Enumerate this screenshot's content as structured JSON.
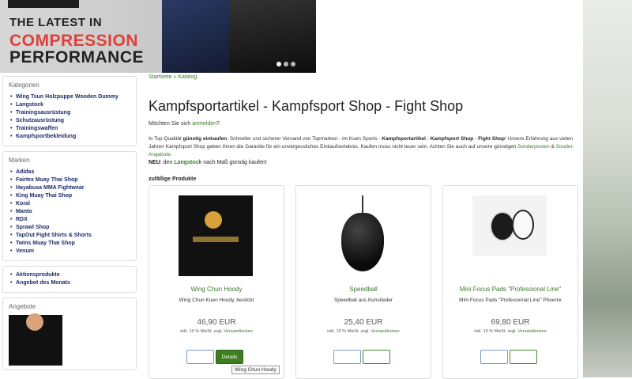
{
  "banner": {
    "line1": "THE LATEST IN",
    "line2": "COMPRESSION",
    "line3": "PERFORMANCE",
    "slides": 3,
    "active_slide": 1
  },
  "breadcrumb": {
    "home": "Startseite",
    "separator": "»",
    "current": "Katalog"
  },
  "sidebar": {
    "categories": {
      "title": "Kategorien",
      "items": [
        "Wing Tsun Holzpuppe Wooden Dummy",
        "Langstock",
        "Trainingsausrüstung",
        "Schutzausrüstung",
        "Trainingswaffen",
        "Kampfsportbekleidung"
      ]
    },
    "brands": {
      "title": "Marken",
      "items": [
        "Adidas",
        "Fairtex Muay Thai Shop",
        "Hayabusa MMA Fightwear",
        "King Muay Thai Shop",
        "Koral",
        "Manto",
        "RDX",
        "Sprawl Shop",
        "TapOut Fight Shirts & Shorts",
        "Twins Muay Thai Shop",
        "Venum"
      ]
    },
    "extra": {
      "items": [
        "Aktionsprodukte",
        "Angebot des Monats"
      ]
    },
    "offers": {
      "title": "Angebote"
    }
  },
  "main": {
    "title": "Kampfsportartikel - Kampfsport Shop - Fight Shop",
    "login_prompt": "Möchten Sie sich",
    "login_link": "anmelden",
    "login_suffix": "?",
    "intro": {
      "p1": "In Top Qualität",
      "b1": "günstig einkaufen",
      "p2": ". Schneller und sicherer Versand von Topmarken - im Kuen Sports -",
      "b2": "Kampfsportartikel",
      "p3": " -",
      "b3": "Kampfsport Shop",
      "p4": " -",
      "b4": "Fight Shop",
      "p5": "! Unsere Erfahrung aus vielen Jahren Kampfsport Shop geben Ihnen die Garantie für ein unvergessliches Einkaufserlebnis. Kaufen muss nicht teuer sein. Achten Sie auch auf unsere günstigen",
      "link1": "Sonderposten",
      "amp": " & ",
      "link2": "Sonder-Angebote",
      "end": "."
    },
    "new_line": {
      "label": "NEU",
      "text1": ": den",
      "link": "Langstock",
      "text2": "nach Maß günstig kaufen!"
    },
    "section_label": "zufällige Produkte"
  },
  "products": [
    {
      "name": "Wing Chun Hoody",
      "desc": "Wing Chun Kuen Hoody, bestickt",
      "price": "46,90 EUR",
      "tax_prefix": "inkl. 19 % MwSt. zzgl.",
      "shipping": "Versandkosten",
      "btn2": "Details"
    },
    {
      "name": "Speedball",
      "desc": "Speedball aus Kunstleder",
      "price": "25,40 EUR",
      "tax_prefix": "inkl. 19 % MwSt. zzgl.",
      "shipping": "Versandkosten",
      "btn2": ""
    },
    {
      "name": "Mini Focus Pads \"Professional Line\"",
      "desc": "Mini Focus Pads \"Professional Line\" Phoenix",
      "price": "69,80 EUR",
      "tax_prefix": "inkl. 19 % MwSt. zzgl.",
      "shipping": "Versandkosten",
      "btn2": ""
    }
  ],
  "tooltip": "Wing Chun Hoody",
  "colors": {
    "link_green": "#3c7a2d",
    "nav_blue": "#1a2c6b",
    "banner_red": "#e0403a"
  }
}
